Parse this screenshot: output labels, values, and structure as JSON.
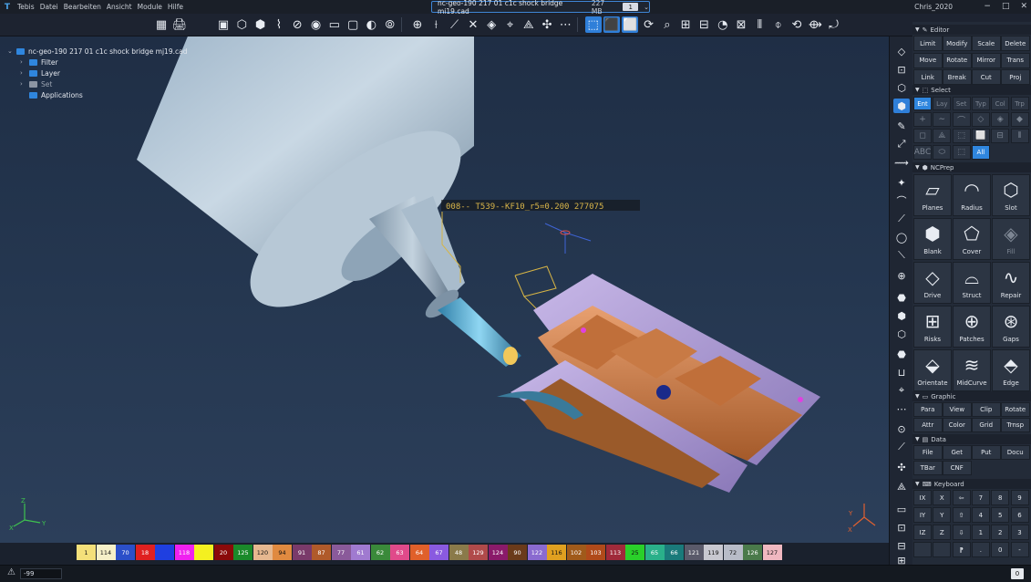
{
  "titlebar": {
    "logo": "T",
    "menu": [
      "Tebis",
      "Datei",
      "Bearbeiten",
      "Ansicht",
      "Module",
      "Hilfe"
    ],
    "file_name": "nc-geo-190 217 01 c1c shock bridge mj19.cad",
    "file_size": "227 MB",
    "file_index": "1",
    "user": "Chris_2020",
    "win_controls": [
      "−",
      "□",
      "✕"
    ]
  },
  "toolbar": {
    "left_icons": [
      "▦",
      "🖨"
    ],
    "groups": [
      [
        "▣",
        "⬡",
        "⬢",
        "⌇",
        "⊘",
        "◉",
        "▭",
        "▢",
        "◐",
        "⦾"
      ],
      [
        "⊕",
        "⟊",
        "⟋",
        "✕",
        "◈",
        "⌖",
        "⟁",
        "✣",
        "⋯"
      ],
      [
        "⬚",
        "⬛",
        "⬜",
        "⟳",
        "⌕",
        "⊞",
        "⊟",
        "◔",
        "⊠",
        "⦀",
        "⌽",
        "⟲",
        "⟴",
        "⤾"
      ]
    ]
  },
  "tree": {
    "root": "nc-geo-190 217 01 c1c shock bridge mj19.cad",
    "children": [
      {
        "label": "Filter",
        "dim": false
      },
      {
        "label": "Layer",
        "dim": false
      },
      {
        "label": "Set",
        "dim": true
      },
      {
        "label": "Applications",
        "dim": false
      }
    ]
  },
  "viewport": {
    "tool_label": "008-- T539--KF10_r5=0.200 277075",
    "axis_y": "Y",
    "axis_z": "Z",
    "axis_x": "X"
  },
  "palette": [
    {
      "n": "1",
      "c": "#f4e07a",
      "t": "#111"
    },
    {
      "n": "114",
      "c": "#f6f0c8",
      "t": "#111"
    },
    {
      "n": "70",
      "c": "#2b4fc9",
      "t": "#fff"
    },
    {
      "n": "18",
      "c": "#e02020",
      "t": "#fff"
    },
    {
      "n": "",
      "c": "#1f3fe0",
      "t": "#fff"
    },
    {
      "n": "118",
      "c": "#f020f0",
      "t": "#fff"
    },
    {
      "n": "",
      "c": "#f4f020",
      "t": "#111"
    },
    {
      "n": "20",
      "c": "#8a0a0a",
      "t": "#fff"
    },
    {
      "n": "125",
      "c": "#1a8a2a",
      "t": "#fff"
    },
    {
      "n": "120",
      "c": "#e6b890",
      "t": "#111"
    },
    {
      "n": "94",
      "c": "#e08a40",
      "t": "#111"
    },
    {
      "n": "91",
      "c": "#7a3a6a",
      "t": "#fff"
    },
    {
      "n": "87",
      "c": "#b05a2a",
      "t": "#fff"
    },
    {
      "n": "77",
      "c": "#8a5a9a",
      "t": "#fff"
    },
    {
      "n": "61",
      "c": "#a07ad0",
      "t": "#fff"
    },
    {
      "n": "62",
      "c": "#3a8a3a",
      "t": "#fff"
    },
    {
      "n": "63",
      "c": "#e04a8a",
      "t": "#fff"
    },
    {
      "n": "64",
      "c": "#e0602a",
      "t": "#fff"
    },
    {
      "n": "67",
      "c": "#8a5ae0",
      "t": "#fff"
    },
    {
      "n": "48",
      "c": "#8a7a4a",
      "t": "#fff"
    },
    {
      "n": "129",
      "c": "#b04a4a",
      "t": "#fff"
    },
    {
      "n": "124",
      "c": "#8a1a6a",
      "t": "#fff"
    },
    {
      "n": "90",
      "c": "#6a3a1a",
      "t": "#fff"
    },
    {
      "n": "122",
      "c": "#8a6ad0",
      "t": "#fff"
    },
    {
      "n": "116",
      "c": "#e0a020",
      "t": "#111"
    },
    {
      "n": "102",
      "c": "#a05a1a",
      "t": "#fff"
    },
    {
      "n": "103",
      "c": "#b04a1a",
      "t": "#fff"
    },
    {
      "n": "113",
      "c": "#a02a3a",
      "t": "#fff"
    },
    {
      "n": "25",
      "c": "#2ad02a",
      "t": "#111"
    },
    {
      "n": "65",
      "c": "#2ab08a",
      "t": "#fff"
    },
    {
      "n": "66",
      "c": "#1a7a7a",
      "t": "#fff"
    },
    {
      "n": "121",
      "c": "#5a5a6a",
      "t": "#fff"
    },
    {
      "n": "119",
      "c": "#c8c8d0",
      "t": "#111"
    },
    {
      "n": "72",
      "c": "#b8bcc8",
      "t": "#111"
    },
    {
      "n": "126",
      "c": "#4a7a4a",
      "t": "#fff"
    },
    {
      "n": "127",
      "c": "#f0b8c0",
      "t": "#111"
    }
  ],
  "status": {
    "field": "-99",
    "right": "0",
    "icon": "⚠"
  },
  "vstrip": [
    "◇",
    "⊡",
    "⬡",
    "⬢",
    "✎",
    "⤢",
    "⟿",
    "✦",
    "⌒",
    "⟋",
    "◯",
    "⟍",
    "⊕",
    "⬣",
    "⬢",
    "⬡",
    "⬣",
    "⊔",
    "⌖",
    "⋯",
    "⊙",
    "⟋",
    "✣",
    "⟁",
    "▭",
    "⊡",
    "⊟",
    "⊞"
  ],
  "editor": {
    "title": "Editor",
    "buttons": [
      "Limit",
      "Modify",
      "Scale",
      "Delete",
      "Move",
      "Rotate",
      "Mirror",
      "Trans",
      "Link",
      "Break",
      "Cut",
      "Proj"
    ]
  },
  "select": {
    "title": "Select",
    "tabs": [
      "Ent",
      "Lay",
      "Set",
      "Typ",
      "Col",
      "Trp"
    ],
    "icons": [
      "+",
      "∼",
      "⌒",
      "◇",
      "◈",
      "◆",
      "◻",
      "⟁",
      "⬚",
      "⬜",
      "⊟",
      "⦀",
      "ABC",
      "⬭",
      "⬚"
    ],
    "all": "All"
  },
  "ncprep": {
    "title": "NCPrep",
    "buttons": [
      {
        "label": "Planes",
        "icon": "▱",
        "dim": false
      },
      {
        "label": "Radius",
        "icon": "◠",
        "dim": false
      },
      {
        "label": "Slot",
        "icon": "⬡",
        "dim": false
      },
      {
        "label": "Blank",
        "icon": "⬢",
        "dim": false
      },
      {
        "label": "Cover",
        "icon": "⬠",
        "dim": false
      },
      {
        "label": "Fill",
        "icon": "◈",
        "dim": true
      },
      {
        "label": "Drive",
        "icon": "◇",
        "dim": false
      },
      {
        "label": "Struct",
        "icon": "⌓",
        "dim": false
      },
      {
        "label": "Repair",
        "icon": "∿",
        "dim": false
      },
      {
        "label": "Risks",
        "icon": "⊞",
        "dim": false
      },
      {
        "label": "Patches",
        "icon": "⊕",
        "dim": false
      },
      {
        "label": "Gaps",
        "icon": "⊛",
        "dim": false
      },
      {
        "label": "Orientate",
        "icon": "⬙",
        "dim": false
      },
      {
        "label": "MidCurve",
        "icon": "≋",
        "dim": false
      },
      {
        "label": "Edge",
        "icon": "⬘",
        "dim": false
      }
    ]
  },
  "graphic": {
    "title": "Graphic",
    "buttons": [
      "Para",
      "View",
      "Clip",
      "Rotate",
      "Attr",
      "Color",
      "Grid",
      "Trnsp"
    ]
  },
  "datasec": {
    "title": "Data",
    "buttons": [
      "File",
      "Get",
      "Put",
      "Docu",
      "TBar",
      "CNF"
    ]
  },
  "keyboard": {
    "title": "Keyboard",
    "keys": [
      [
        "IX",
        "X",
        "⇦",
        "7",
        "8",
        "9"
      ],
      [
        "IY",
        "Y",
        "⇧",
        "4",
        "5",
        "6"
      ],
      [
        "IZ",
        "Z",
        "⇩",
        "1",
        "2",
        "3"
      ],
      [
        "",
        "",
        "⁋",
        ".",
        "0",
        "-"
      ]
    ]
  }
}
